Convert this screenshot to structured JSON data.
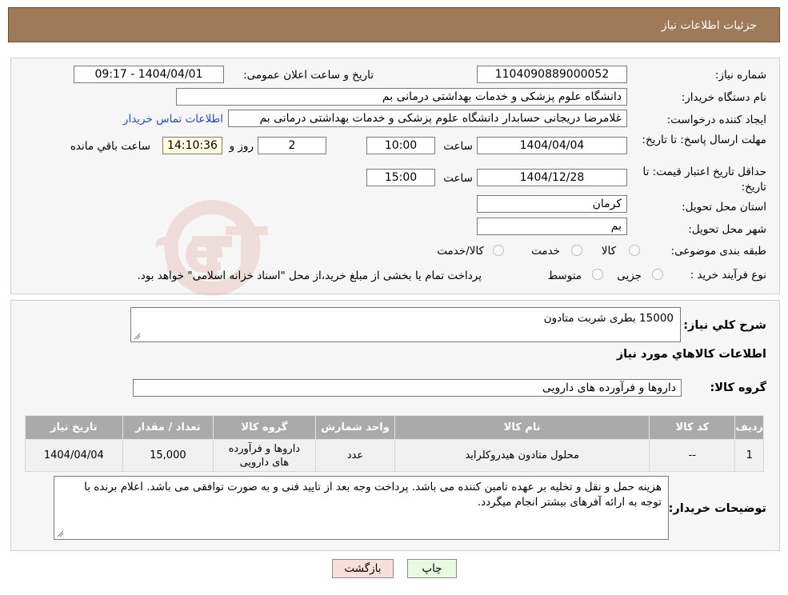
{
  "header": {
    "title": "جزئیات اطلاعات نیاز"
  },
  "form": {
    "need_number_label": "شماره نیاز:",
    "need_number": "1104090889000052",
    "announce_label": "تاریخ و ساعت اعلان عمومی:",
    "announce_value": "1404/04/01 - 09:17",
    "buyer_org_label": "نام دستگاه خریدار:",
    "buyer_org": "دانشگاه علوم پزشکی و خدمات بهداشتی  درمانی بم",
    "requester_label": "ایجاد کننده درخواست:",
    "requester": "غلامرضا دریجانی حسابدار دانشگاه علوم پزشکی و خدمات بهداشتی  درمانی بم",
    "contact_link": "اطلاعات تماس خریدار",
    "deadline_label": "مهلت ارسال پاسخ: تا تاریخ:",
    "deadline_date": "1404/04/04",
    "time_label": "ساعت",
    "deadline_time": "10:00",
    "days_value": "2",
    "days_label": "روز و",
    "remaining_time": "14:10:36",
    "remaining_label": "ساعت باقي مانده",
    "validity_label": "حداقل تاریخ اعتبار قیمت: تا تاریخ:",
    "validity_date": "1404/12/28",
    "validity_time": "15:00",
    "province_label": "استان محل تحویل:",
    "province": "کرمان",
    "city_label": "شهر محل تحویل:",
    "city": "بم",
    "category_label": "طبقه بندی موضوعی:",
    "category_options": [
      "کالا",
      "خدمت",
      "کالا/خدمت"
    ],
    "purchase_type_label": "نوع فرآیند خرید :",
    "purchase_options": [
      "جزیی",
      "متوسط"
    ],
    "purchase_note": "پرداخت تمام یا بخشی از مبلغ خرید،از محل \"اسناد خزانه اسلامی\" خواهد بود."
  },
  "summary": {
    "general_desc_label": "شرح کلي نیاز:",
    "general_desc": "15000 بطری شربت متادون",
    "goods_info_title": "اطلاعات کالاهاي مورد نیاز",
    "goods_group_label": "گروه کالا:",
    "goods_group": "داروها و فرآورده های دارویی"
  },
  "table": {
    "headers": [
      "ردیف",
      "کد کالا",
      "نام کالا",
      "واحد شمارش",
      "گروه کالا",
      "تعداد / مقدار",
      "تاریخ نیاز"
    ],
    "rows": [
      [
        "1",
        "--",
        "محلول متادون هیدروکلراید",
        "عدد",
        "داروها و فرآورده های دارویی",
        "15,000",
        "1404/04/04"
      ]
    ]
  },
  "buyer_notes": {
    "label": "توضیحات خریدار:",
    "text": "هزینه حمل و نقل و تخلیه بر عهده تامین کننده می باشد. پرداخت وجه بعد از تایید فنی و به صورت توافقی می باشد. اعلام برنده با توجه به ارائه آفرهای بیشتر انجام میگردد."
  },
  "buttons": {
    "print": "چاپ",
    "back": "بازگشت"
  },
  "colors": {
    "header_bg": "#9f7a59",
    "link": "#1f4bd0",
    "back_btn_bg": "#f9dede",
    "print_btn_bg": "#e8fbe0"
  }
}
